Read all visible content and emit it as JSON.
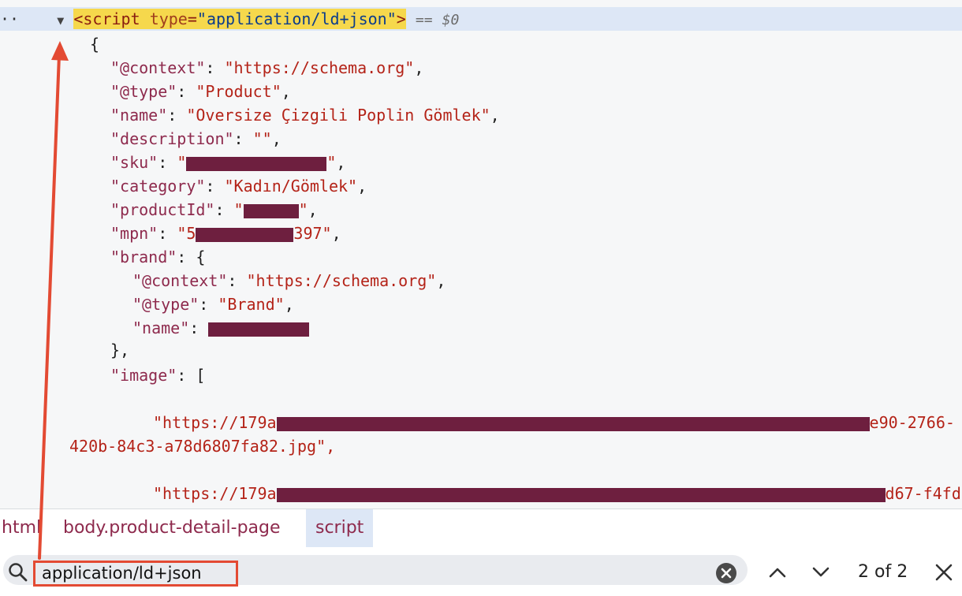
{
  "elements_panel": {
    "selected_tag": {
      "open": "<script",
      "attr_name": "type",
      "attr_value": "\"application/ld+json\"",
      "close": ">",
      "eq": "==",
      "var": "$0",
      "expander": "▼",
      "ellipsis": "··"
    },
    "json_lines": {
      "open_brace": "{",
      "context_key": "\"@context\"",
      "context_val": "\"https://schema.org\"",
      "type_key": "\"@type\"",
      "type_val": "\"Product\"",
      "name_key": "\"name\"",
      "name_val": "\"Oversize Çizgili Poplin Gömlek\"",
      "desc_key": "\"description\"",
      "desc_val": "\"\"",
      "sku_key": "\"sku\"",
      "category_key": "\"category\"",
      "category_val": "\"Kadın/Gömlek\"",
      "productid_key": "\"productId\"",
      "mpn_key": "\"mpn\"",
      "mpn_prefix": "\"5",
      "mpn_suffix": "397\"",
      "brand_key": "\"brand\"",
      "brand_context_key": "\"@context\"",
      "brand_context_val": "\"https://schema.org\"",
      "brand_type_key": "\"@type\"",
      "brand_type_val": "\"Brand\"",
      "brand_name_key": "\"name\"",
      "close_brace": "},",
      "image_key": "\"image\"",
      "open_bracket": "[",
      "img1_prefix": "\"https://179a",
      "img1_suffix": "e90-2766-",
      "img1_cont": "420b-84c3-a78d6807fa82.jpg\",",
      "img2_prefix": "\"https://179a",
      "img2_suffix": "d67-f4fd-"
    }
  },
  "breadcrumbs": [
    "html",
    "body.product-detail-page",
    "script"
  ],
  "search": {
    "value": "application/ld+json",
    "match_count": "2 of 2"
  },
  "colors": {
    "highlight": "#f6d84c",
    "selection_row": "#dde7f6",
    "annotation_red": "#e34a33",
    "redaction": "#6e1f3f"
  }
}
